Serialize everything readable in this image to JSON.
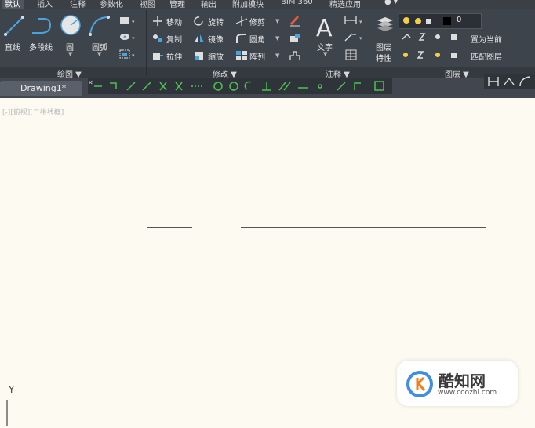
{
  "menubar": {
    "tabs": [
      "默认",
      "插入",
      "注释",
      "参数化",
      "视图",
      "管理",
      "输出",
      "附加模块",
      "BIM 360",
      "精选应用"
    ]
  },
  "draw_panel": {
    "title": "绘图 ▼",
    "line": "直线",
    "polyline": "多段线",
    "circle": "圆",
    "arc": "圆弧"
  },
  "modify_panel": {
    "title": "修改 ▼",
    "move": "移动",
    "rotate": "旋转",
    "trim": "修剪",
    "copy": "复制",
    "mirror": "镜像",
    "fillet": "圆角",
    "stretch": "拉伸",
    "scale": "缩放",
    "array": "阵列"
  },
  "annotation_panel": {
    "title": "注释 ▼",
    "text": "文字"
  },
  "layers_panel": {
    "title": "图层 ▼",
    "layer_properties_1": "图层",
    "layer_properties_2": "特性",
    "current_layer": "0",
    "set_current": "置为当前",
    "match_layer": "匹配图层"
  },
  "document": {
    "tab_label": "Drawing1*",
    "viewport_label": "[-][俯视][二维线框]"
  },
  "ucs": {
    "y_label": "Y"
  },
  "watermark": {
    "name": "酷知网",
    "url": "www.coozhi.com"
  },
  "colors": {
    "ribbon_bg": "#3e444c",
    "canvas_bg": "#fdfaf1",
    "accent_blue": "#4aa3df",
    "line_stroke": "#555555"
  }
}
